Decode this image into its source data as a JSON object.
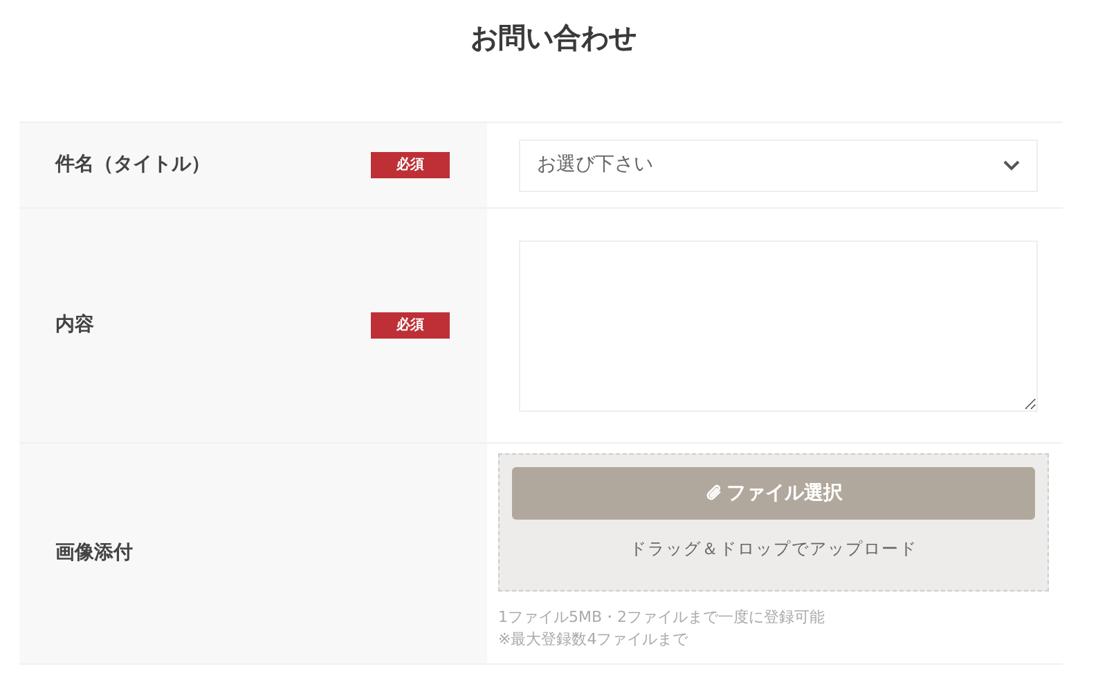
{
  "title": "お問い合わせ",
  "rows": [
    {
      "kind": "select",
      "label": "件名（タイトル）",
      "required": true,
      "badge": "必須",
      "placeholder": "お選び下さい"
    },
    {
      "kind": "textarea",
      "label": "内容",
      "required": true,
      "badge": "必須"
    },
    {
      "kind": "upload",
      "label": "画像添付",
      "required": false,
      "button": "ファイル選択",
      "drop_text": "ドラッグ＆ドロップでアップロード",
      "notes": [
        "1ファイル5MB・2ファイルまで一度に登録可能",
        "※最大登録数4ファイルまで"
      ]
    }
  ]
}
